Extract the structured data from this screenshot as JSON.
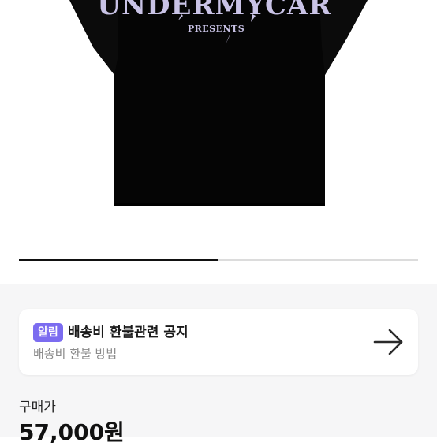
{
  "product": {
    "image_alt": "black t-shirt",
    "print_text": "UNDERMYCAR",
    "print_subtext": "PRESENTS",
    "carousel_progress": 0.5
  },
  "notice": {
    "badge": "알림",
    "title": "배송비 환불관련 공지",
    "subtitle": "배송비 환불 방법",
    "icon": "arrow-right-icon"
  },
  "price": {
    "label": "구매가",
    "value": "57,000원"
  },
  "colors": {
    "badge_bg": "#7b6cf0",
    "shirt": "#050505",
    "print": "#c9c3e6",
    "section_bg": "#f6f6f7"
  }
}
